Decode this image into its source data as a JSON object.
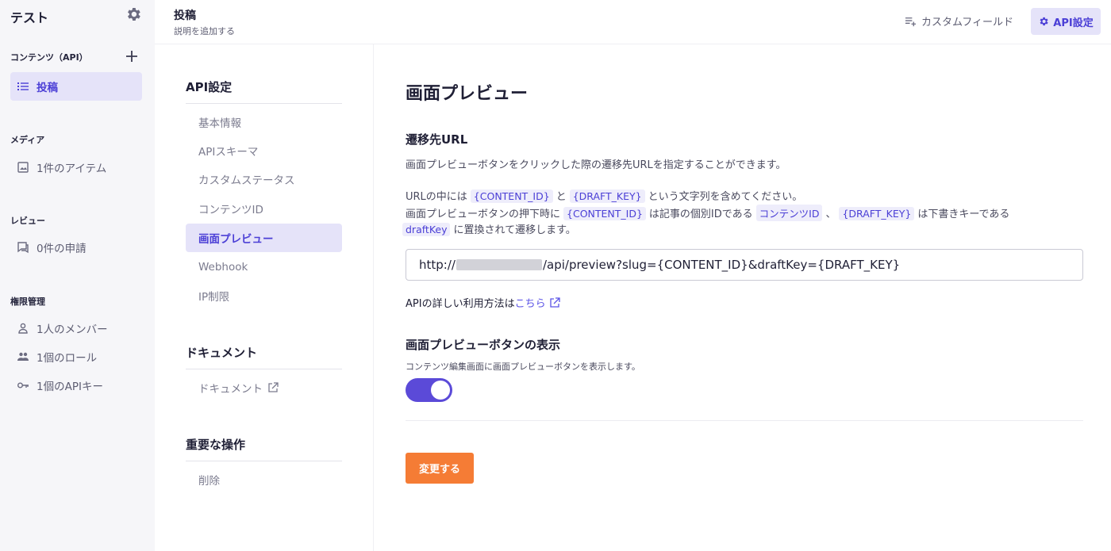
{
  "sidebar": {
    "title": "テスト",
    "contents_section": "コンテンツ（API）",
    "items_content": [
      {
        "label": "投稿"
      }
    ],
    "media_section": "メディア",
    "media_item": "1件のアイテム",
    "review_section": "レビュー",
    "review_item": "0件の申請",
    "perm_section": "権限管理",
    "perm_items": [
      {
        "label": "1人のメンバー"
      },
      {
        "label": "1個のロール"
      },
      {
        "label": "1個のAPIキー"
      }
    ]
  },
  "header": {
    "title": "投稿",
    "description": "説明を追加する",
    "custom_field": "カスタムフィールド",
    "api_settings": "API設定"
  },
  "menu": {
    "api_heading": "API設定",
    "api_items": [
      {
        "label": "基本情報"
      },
      {
        "label": "APIスキーマ"
      },
      {
        "label": "カスタムステータス"
      },
      {
        "label": "コンテンツID"
      },
      {
        "label": "画面プレビュー"
      },
      {
        "label": "Webhook"
      },
      {
        "label": "IP制限"
      }
    ],
    "doc_heading": "ドキュメント",
    "doc_item": "ドキュメント",
    "danger_heading": "重要な操作",
    "danger_item": "削除"
  },
  "main": {
    "title": "画面プレビュー",
    "url_heading": "遷移先URL",
    "url_desc": "画面プレビューボタンをクリックした際の遷移先URLを指定することができます。",
    "line1_a": "URLの中には",
    "chip_content_id": "{CONTENT_ID}",
    "line1_b": "と",
    "chip_draft_key": "{DRAFT_KEY}",
    "line1_c": "という文字列を含めてください。",
    "line2_a": "画面プレビューボタンの押下時に",
    "line2_b": "は記事の個別IDである",
    "chip_contents_id": "コンテンツID",
    "line2_c": "、",
    "line2_d": "は下書きキーである",
    "chip_draftkey": "draftKey",
    "line3": "に置換されて遷移します。",
    "url_prefix": "http://",
    "url_suffix": "/api/preview?slug={CONTENT_ID}&draftKey={DRAFT_KEY}",
    "api_note": "APIの詳しい利用方法は",
    "api_link": "こちら",
    "toggle_heading": "画面プレビューボタンの表示",
    "toggle_desc": "コンテンツ編集画面に画面プレビューボタンを表示します。",
    "toggle_on": true,
    "submit": "変更する"
  }
}
